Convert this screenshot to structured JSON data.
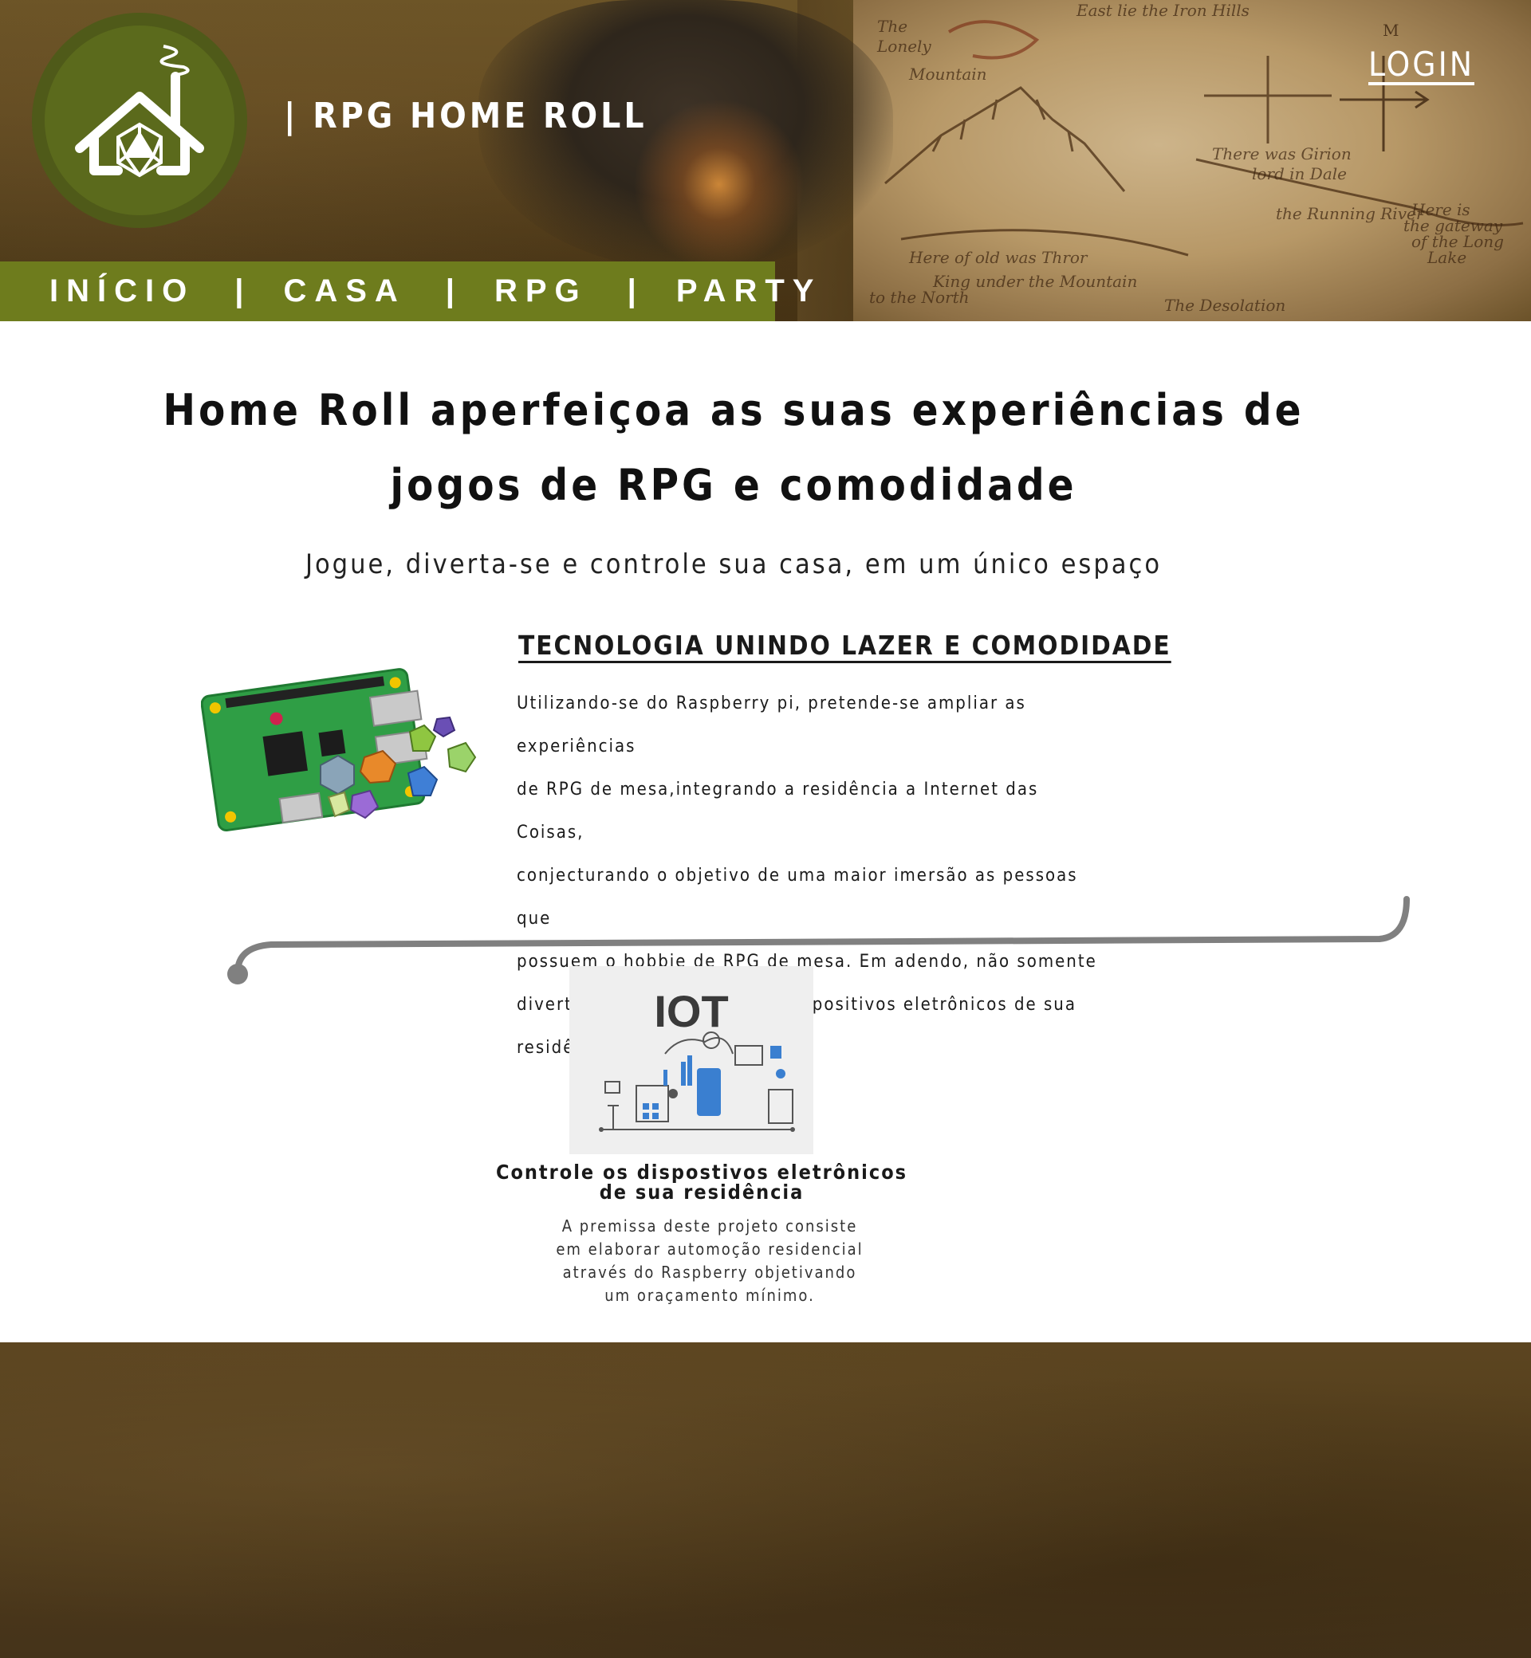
{
  "header": {
    "site_title": "| RPG HOME ROLL",
    "login_label": "LOGIN"
  },
  "nav": {
    "items": [
      "INÍCIO",
      "CASA",
      "RPG",
      "PARTY"
    ],
    "separator": "|"
  },
  "main": {
    "headline_line1": "Home Roll aperfeiçoa as suas experiências de",
    "headline_line2": "jogos de RPG e comodidade",
    "subheadline": "Jogue, diverta-se e controle sua casa, em um único espaço",
    "feature": {
      "title": "TECNOLOGIA UNINDO LAZER E COMODIDADE",
      "lines": [
        "Utilizando-se do Raspberry pi, pretende-se ampliar as experiências",
        "de RPG de mesa,integrando a residência a Internet das Coisas,",
        "conjecturando o objetivo de uma maior imersão as pessoas que",
        "possuem o hobbie de RPG de mesa. Em adendo, não somente",
        "divertir-se, mas verificar os dispositivos eletrônicos de sua",
        "residência."
      ]
    },
    "card": {
      "image_label": "IOT",
      "title_line1": "Controle os dispostivos eletrônicos",
      "title_line2": "de sua residência",
      "text_lines": [
        "A premissa deste projeto consiste",
        "em elaborar automoção residencial",
        "através do Raspberry objetivando",
        "um oraçamento mínimo."
      ]
    }
  },
  "colors": {
    "header_brown": "#5a4420",
    "nav_green": "#6e7c1d",
    "logo_green": "#5b6a1c",
    "footer_brown": "#4e3a1a",
    "divider_gray": "#808080"
  },
  "icons": {
    "logo": "house-d20-logo-icon",
    "feature_image": "raspberry-pi-dice-image",
    "card_image": "iot-illustration-image"
  }
}
